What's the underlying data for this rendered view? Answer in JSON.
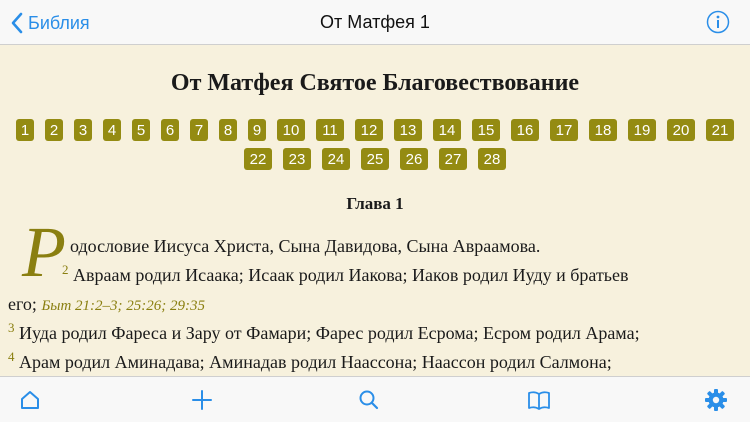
{
  "navbar": {
    "back_label": "Библия",
    "title": "От Матфея 1"
  },
  "book": {
    "title": "От Матфея Святое Благовествование",
    "chapters": [
      "1",
      "2",
      "3",
      "4",
      "5",
      "6",
      "7",
      "8",
      "9",
      "10",
      "11",
      "12",
      "13",
      "14",
      "15",
      "16",
      "17",
      "18",
      "19",
      "20",
      "21",
      "22",
      "23",
      "24",
      "25",
      "26",
      "27",
      "28"
    ]
  },
  "chapter": {
    "heading": "Глава 1",
    "dropcap": "Р",
    "v1_text": "одословие Иисуса Христа, Сына Давидова, Сына Авраамова.",
    "v2_num": "2",
    "v2_text_a": "Авраам родил Исаака; Исаак родил Иакова; Иаков родил Иуду и братьев",
    "v2_text_b": "его;",
    "v2_ref": "Быт 21:2–3; 25:26; 29:35",
    "v3_num": "3",
    "v3_text": "Иуда родил Фареса и Зару от Фамари; Фарес родил Есрома; Есром родил Арама;",
    "v4_num": "4",
    "v4_text": "Арам родил Аминадава; Аминадав родил Наассона; Наассон родил Салмона;"
  },
  "tabbar": {
    "icons": [
      "home-icon",
      "plus-icon",
      "search-icon",
      "book-icon",
      "gear-icon"
    ]
  },
  "colors": {
    "accent": "#2a8ee8",
    "chapter_badge": "#948b12",
    "background": "#f7f1dd"
  }
}
